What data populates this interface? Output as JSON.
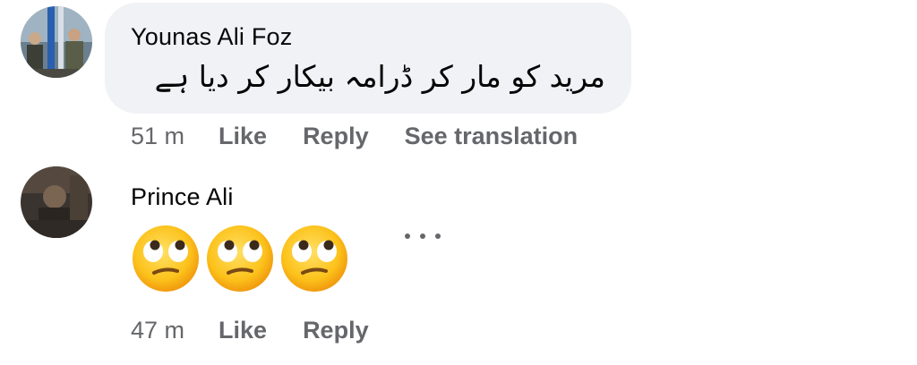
{
  "comments": [
    {
      "author": "Younas Ali Foz",
      "text": "مرید کو مار کر ڈرامہ بیکار کر دیا ہے",
      "time": "51 m",
      "like_label": "Like",
      "reply_label": "Reply",
      "translate_label": "See translation"
    },
    {
      "author": "Prince Ali",
      "emoji": [
        "face-with-rolling-eyes",
        "face-with-rolling-eyes",
        "face-with-rolling-eyes"
      ],
      "time": "47 m",
      "like_label": "Like",
      "reply_label": "Reply"
    }
  ],
  "colors": {
    "bubble": "#f0f2f5",
    "meta_text": "#65676b",
    "primary_text": "#050505"
  },
  "icons": {
    "more_options": "more-options-icon"
  }
}
